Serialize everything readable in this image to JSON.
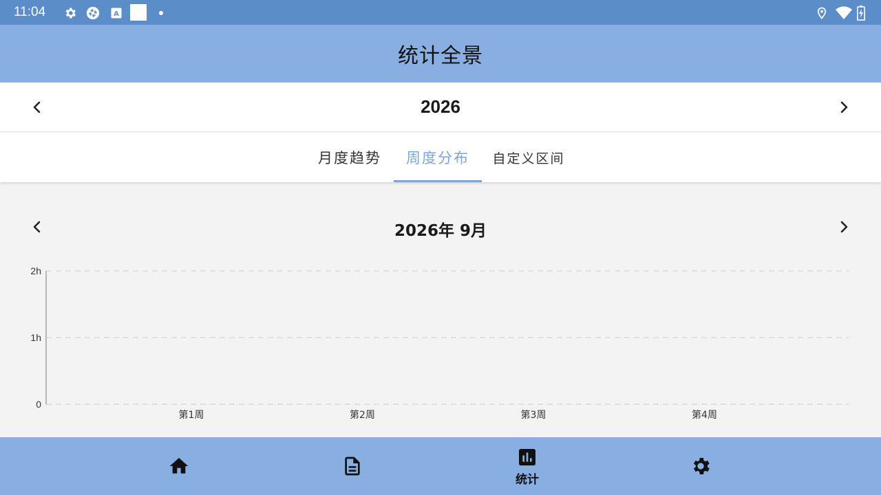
{
  "status_bar": {
    "time": "11:04",
    "left_icons": [
      "settings-icon",
      "sync-icon",
      "font-icon",
      "square-icon",
      "dot-icon"
    ],
    "right_icons": [
      "location-icon",
      "wifi-icon",
      "battery-icon"
    ]
  },
  "app_bar": {
    "title": "统计全景"
  },
  "year_selector": {
    "year": "2026",
    "prev_icon": "chevron-left-icon",
    "next_icon": "chevron-right-icon"
  },
  "tabs": [
    {
      "label": "月度趋势",
      "active": false
    },
    {
      "label": "周度分布",
      "active": true
    },
    {
      "label": "自定义区间",
      "active": false
    }
  ],
  "month_selector": {
    "month": "2026年 9月"
  },
  "chart_data": {
    "type": "bar",
    "categories": [
      "第1周",
      "第2周",
      "第3周",
      "第4周"
    ],
    "values": [
      0,
      0,
      0,
      0
    ],
    "y_ticks": [
      "0",
      "1h",
      "2h"
    ],
    "ylim": [
      0,
      2
    ],
    "yunit": "h",
    "grid": true
  },
  "bottom_nav": [
    {
      "icon": "home-icon",
      "label": "",
      "active": false
    },
    {
      "icon": "document-icon",
      "label": "",
      "active": false
    },
    {
      "icon": "bar-chart-icon",
      "label": "统计",
      "active": true
    },
    {
      "icon": "gear-icon",
      "label": "",
      "active": false
    }
  ],
  "colors": {
    "status_bar": "#5b8ec9",
    "app_bar": "#89aee2",
    "accent": "#7aa6da",
    "background": "#f3f3f3"
  }
}
